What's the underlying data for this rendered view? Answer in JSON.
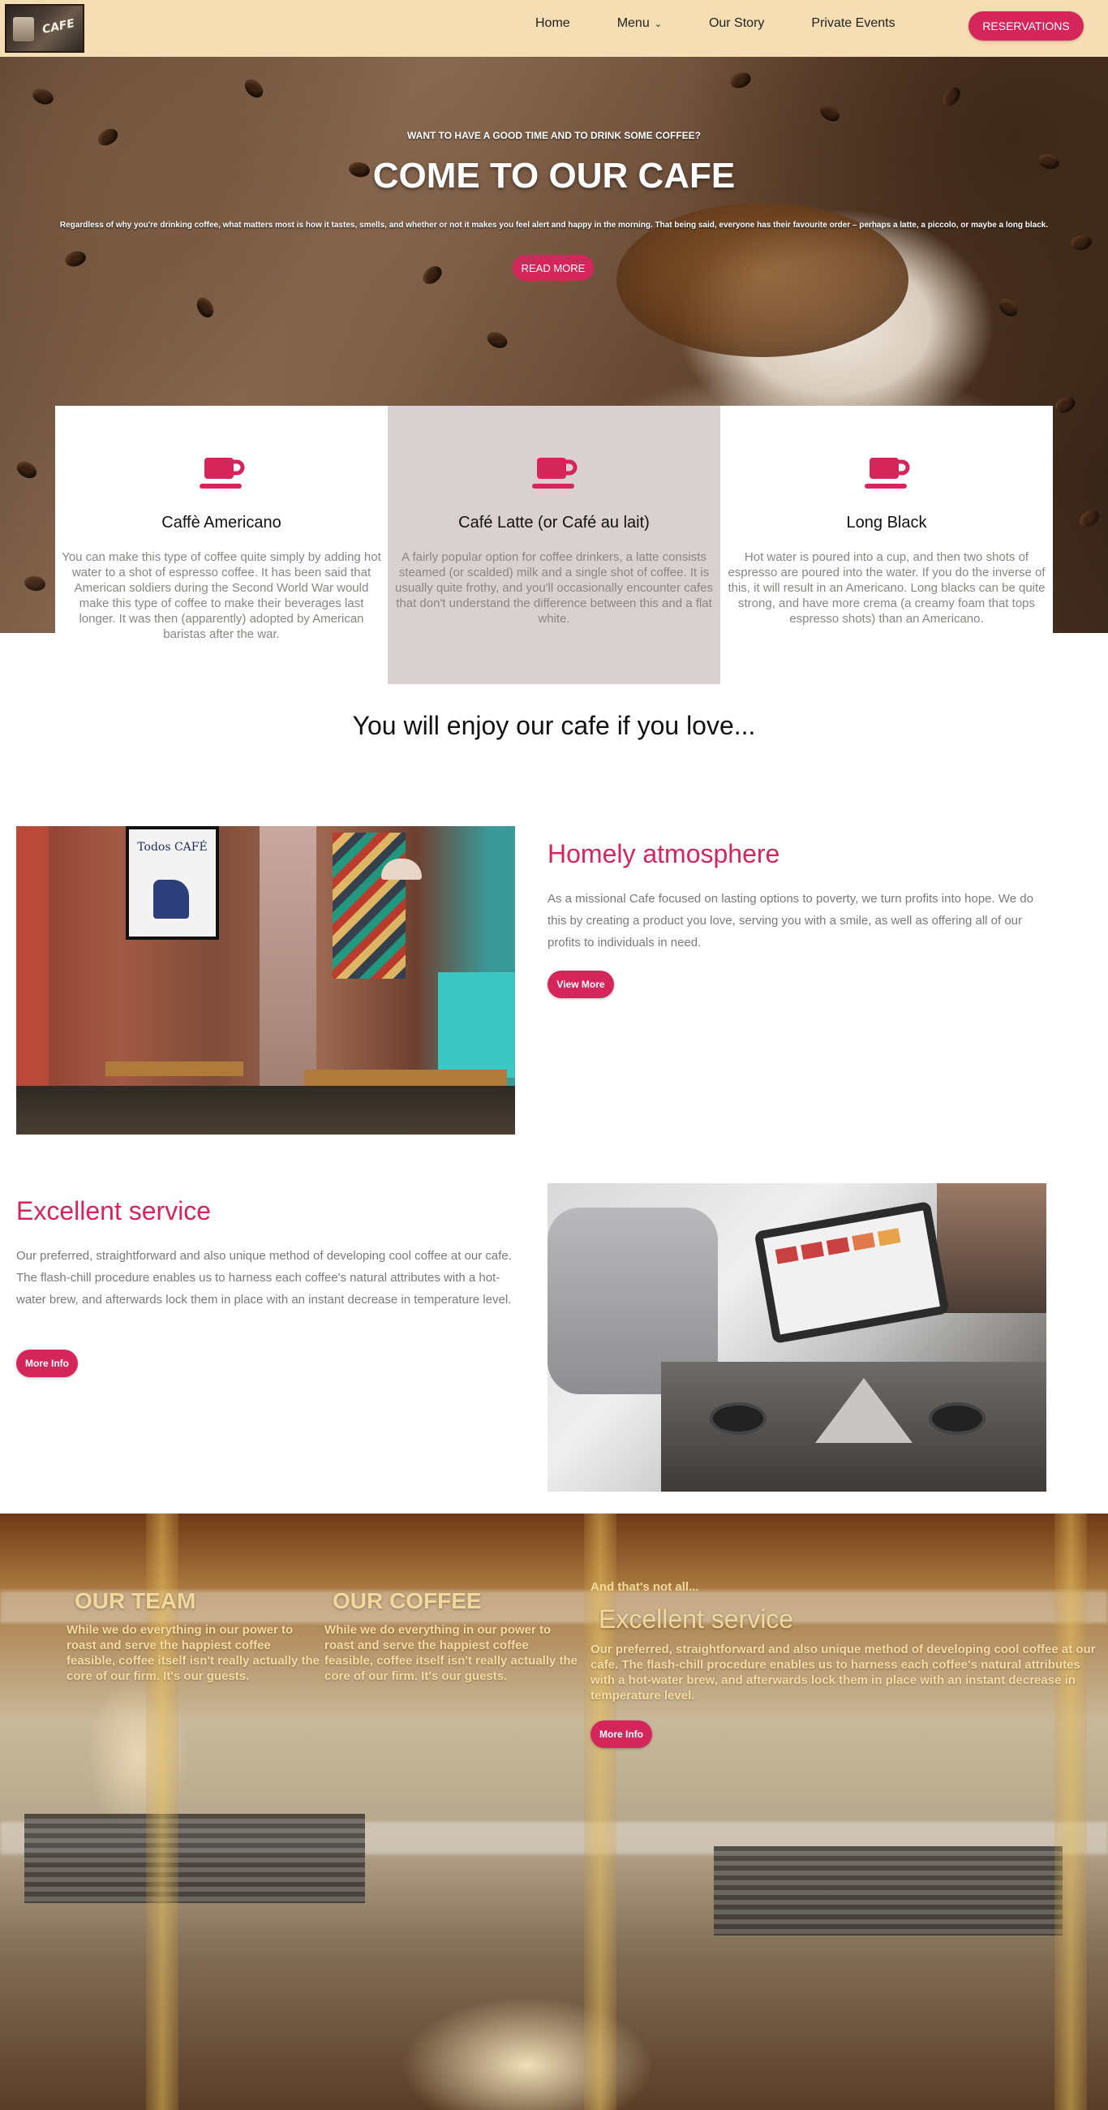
{
  "nav": {
    "logo_text": "CAFE",
    "links": [
      "Home",
      "Menu",
      "Our Story",
      "Private Events"
    ],
    "menu_chevron": "⌄",
    "reserve_label": "RESERVATIONS"
  },
  "hero": {
    "subtitle": "WANT TO HAVE A GOOD TIME AND TO DRINK SOME COFFEE?",
    "title": "COME TO OUR CAFE",
    "description": "Regardless of why you're drinking coffee, what matters most is how it tastes, smells, and whether or not it makes you feel alert and happy in the morning. That being said, everyone has their favourite order – perhaps a latte, a piccolo, or maybe a long black.",
    "button_label": "READ MORE"
  },
  "cards": [
    {
      "icon": "coffee-cup-icon",
      "title": "Caffè Americano",
      "text": "You can make this type of coffee quite simply by adding hot water to a shot of espresso coffee. It has been said that American soldiers during the Second World War would make this type of coffee to make their beverages last longer. It was then (apparently) adopted by American baristas after the war."
    },
    {
      "icon": "coffee-cup-icon",
      "title": "Café Latte (or Café au lait)",
      "text": "A fairly popular option for coffee drinkers, a latte consists steamed (or scalded) milk and a single shot of coffee. It is usually quite frothy, and you'll occasionally encounter cafes that don't understand the difference between this and a flat white."
    },
    {
      "icon": "coffee-cup-icon",
      "title": "Long Black",
      "text": "Hot water is poured into a cup, and then two shots of espresso are poured into the water. If you do the inverse of this, it will result in an Americano. Long blacks can be quite strong, and have more crema (a creamy foam that tops espresso shots) than an Americano."
    }
  ],
  "enjoy_heading": "You will enjoy our cafe if you love...",
  "features": {
    "atmosphere": {
      "title": "Homely atmosphere",
      "text": "As a missional Cafe focused on lasting options to poverty, we turn profits into hope. We do this by creating a product you love, serving you with a smile, as well as offering all of our profits to individuals in need.",
      "button_label": "View More",
      "poster_text": "Todos CAFÉ"
    },
    "service": {
      "title": "Excellent service",
      "text": "Our preferred, straightforward and also unique method of developing cool coffee at our cafe. The flash-chill procedure enables us to harness each coffee's natural attributes with a hot-water brew, and afterwards lock them in place with an instant decrease in temperature level.",
      "button_label": "More Info"
    }
  },
  "bottom": {
    "team": {
      "heading": "OUR TEAM",
      "text": "While we do everything in our power to roast and serve the happiest coffee feasible, coffee itself isn't really actually the core of our firm. It's our guests."
    },
    "coffee": {
      "heading": "OUR COFFEE",
      "text": "While we do everything in our power to roast and serve the happiest coffee feasible, coffee itself isn't really actually the core of our firm. It's our guests."
    },
    "service": {
      "kicker": "And that's not all...",
      "heading": "Excellent service",
      "text": "Our preferred, straightforward and also unique method of developing cool coffee at our cafe. The flash-chill procedure enables us to harness each coffee's natural attributes with a hot-water brew, and afterwards lock them in place with an instant decrease in temperature level.",
      "button_label": "More Info"
    }
  },
  "colors": {
    "accent": "#d5265b",
    "nav_background": "#f5deb3",
    "card_alt_background": "#d9d1d1",
    "bottom_text": "#f3d89a"
  }
}
